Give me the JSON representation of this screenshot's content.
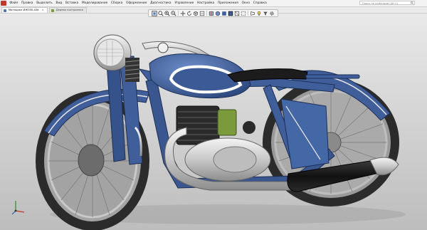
{
  "window": {
    "menu_items": [
      "Файл",
      "Правка",
      "Выделить",
      "Вид",
      "Вставка",
      "Моделирование",
      "Сборка",
      "Оформление",
      "Диагностика",
      "Управление",
      "Настройка",
      "Приложения",
      "Окно",
      "Справка"
    ],
    "search_placeholder": "Поиск по командам (Alt+/)",
    "accent_color": "#c0392b"
  },
  "tabs": [
    {
      "label": "Мотоцикл ИЖ350.a3d",
      "active": true,
      "icon": "assembly-icon"
    },
    {
      "label": "Дерево построения",
      "active": false,
      "icon": "tree-icon"
    }
  ],
  "view_toolbar": {
    "buttons": [
      "zoom-fit-icon",
      "zoom-window-icon",
      "zoom-in-icon",
      "zoom-out-icon",
      "pan-icon",
      "rotate-icon",
      "view-orientation-icon",
      "standard-views-icon",
      "section-icon",
      "display-mode-icon",
      "shaded-icon",
      "shaded-edges-icon",
      "wireframe-icon",
      "hidden-lines-icon",
      "perspective-icon",
      "lighting-icon",
      "filter-icon",
      "settings-icon"
    ]
  },
  "scene": {
    "subject": "motorcycle-3d-model",
    "body_color": "#3f5e9a",
    "tire_color": "#2b2b2b",
    "chrome_color": "#d6d6d6"
  }
}
